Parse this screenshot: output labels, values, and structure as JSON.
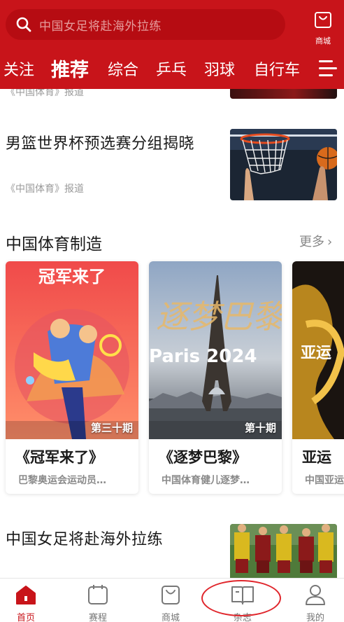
{
  "header": {
    "search_placeholder": "中国女足将赴海外拉练",
    "mall_label": "商城",
    "tabs": [
      {
        "label": "关注",
        "active": false
      },
      {
        "label": "推荐",
        "active": true
      },
      {
        "label": "综合",
        "active": false
      },
      {
        "label": "乒乓",
        "active": false
      },
      {
        "label": "羽球",
        "active": false
      },
      {
        "label": "自行车",
        "active": false
      }
    ]
  },
  "feed": {
    "prev_source": "《中国体育》报道",
    "articles": [
      {
        "title": "男篮世界杯预选赛分组揭晓",
        "source": "《中国体育》报道",
        "thumb": "basketball-hoop"
      },
      {
        "title": "中国女足将赴海外拉练",
        "thumb": "women-football-team"
      }
    ]
  },
  "section": {
    "title": "中国体育制造",
    "more_label": "更多"
  },
  "cards": [
    {
      "cover_text": "冠军来了",
      "issue": "第三十期",
      "title": "《冠军来了》",
      "desc": "巴黎奥运会运动员…"
    },
    {
      "cover_text": "逐梦巴黎",
      "cover_sub": "Paris 2024",
      "issue": "第十期",
      "title": "《逐梦巴黎》",
      "desc": "中国体育健儿逐梦…"
    },
    {
      "cover_text": "亚运",
      "issue": "",
      "title": "亚运",
      "desc": "中国亚运"
    }
  ],
  "bottom_nav": [
    {
      "label": "首页",
      "icon": "home-icon",
      "active": true
    },
    {
      "label": "赛程",
      "icon": "calendar-icon",
      "active": false
    },
    {
      "label": "商城",
      "icon": "bag-icon",
      "active": false
    },
    {
      "label": "杂志",
      "icon": "book-icon",
      "active": false
    },
    {
      "label": "我的",
      "icon": "user-icon",
      "active": false
    }
  ],
  "colors": {
    "brand_red": "#c8141a",
    "highlight_ring": "#e0262c"
  }
}
